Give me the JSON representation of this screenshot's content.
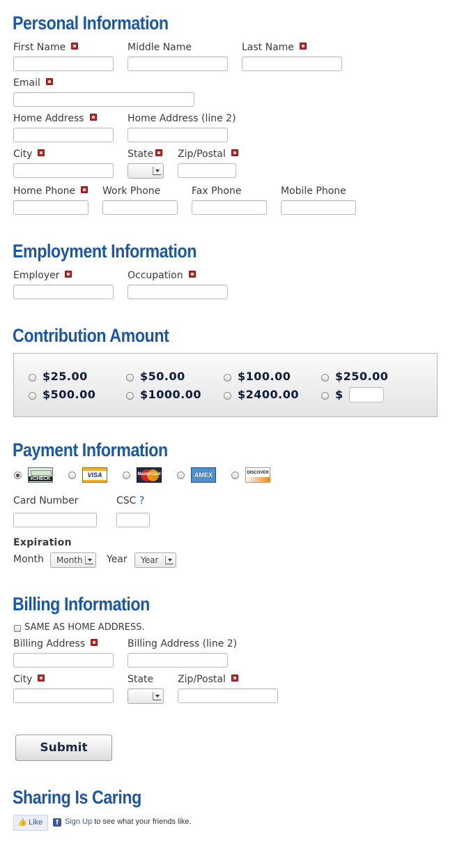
{
  "personal": {
    "title": "Personal Information",
    "first_name": "First Name",
    "middle_name": "Middle Name",
    "last_name": "Last Name",
    "email": "Email",
    "home_address": "Home Address",
    "home_address2": "Home Address (line 2)",
    "city": "City",
    "state": "State",
    "zip": "Zip/Postal",
    "home_phone": "Home Phone",
    "work_phone": "Work Phone",
    "fax_phone": "Fax Phone",
    "mobile_phone": "Mobile Phone"
  },
  "employment": {
    "title": "Employment Information",
    "employer": "Employer",
    "occupation": "Occupation"
  },
  "contribution": {
    "title": "Contribution Amount",
    "amounts": [
      "$25.00",
      "$50.00",
      "$100.00",
      "$250.00",
      "$500.00",
      "$1000.00",
      "$2400.00"
    ],
    "other_prefix": "$"
  },
  "payment": {
    "title": "Payment Information",
    "methods": [
      "eCHECK",
      "VISA",
      "MasterCard",
      "AMEX",
      "DISCOVER"
    ],
    "selected_method": "eCHECK",
    "card_number": "Card Number",
    "csc": "CSC",
    "csc_help": "?",
    "expiration": "Expiration",
    "month": "Month",
    "month_select": "Month",
    "year": "Year",
    "year_select": "Year"
  },
  "billing": {
    "title": "Billing Information",
    "same_as_home": "SAME AS HOME ADDRESS.",
    "billing_address": "Billing Address",
    "billing_address2": "Billing Address (line 2)",
    "city": "City",
    "state": "State",
    "zip": "Zip/Postal"
  },
  "submit_label": "Submit",
  "sharing": {
    "title": "Sharing Is Caring",
    "like": "Like",
    "sign_up": "Sign Up",
    "sign_up_suffix": " to see what your friends like."
  },
  "colors": {
    "heading": "#1b57a4",
    "required": "#b02a2a",
    "facebook": "#3b5998"
  }
}
